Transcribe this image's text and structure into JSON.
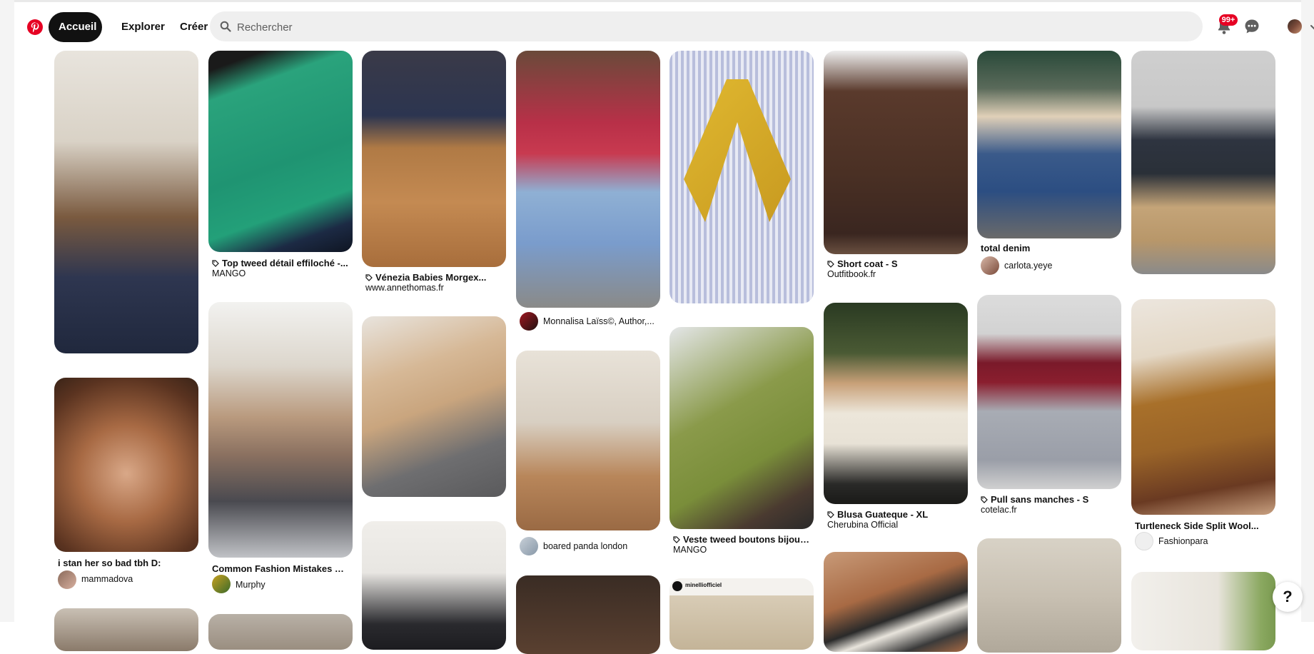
{
  "header": {
    "nav": [
      "Accueil",
      "Explorer",
      "Créer"
    ],
    "search_placeholder": "Rechercher",
    "notifications_count": "99+"
  },
  "pins": [
    {
      "title": "",
      "creator": ""
    },
    {
      "title": "i stan her so bad tbh D:",
      "creator": "mammadova"
    },
    {
      "title": "Top tweed détail effiloché -...",
      "source": "MANGO"
    },
    {
      "title": "Common Fashion Mistakes Tha...",
      "creator": "Murphy"
    },
    {
      "title": "Vénezia Babies Morgex...",
      "source": "www.annethomas.fr"
    },
    {
      "title": "",
      "creator": "Monnalisa Laïss©, Author,..."
    },
    {
      "title": "",
      "creator": "boared panda london"
    },
    {
      "title": "Veste tweed boutons bijoux ...",
      "source": "MANGO"
    },
    {
      "title": "",
      "creator": "minelliofficiel"
    },
    {
      "title": "Short coat - S",
      "source": "Outfitbook.fr"
    },
    {
      "title": "Blusa Guateque - XL",
      "source": "Cherubina Official"
    },
    {
      "title": "total denim",
      "creator": "carlota.yeye"
    },
    {
      "title": "Pull sans manches - S",
      "source": "cotelac.fr"
    },
    {
      "title": "Turtleneck Side Split Wool...",
      "creator": "Fashionpara"
    }
  ],
  "help_label": "?",
  "colors": {
    "brand": "#e60023",
    "active_nav": "#111111",
    "search_bg": "#efefef"
  }
}
